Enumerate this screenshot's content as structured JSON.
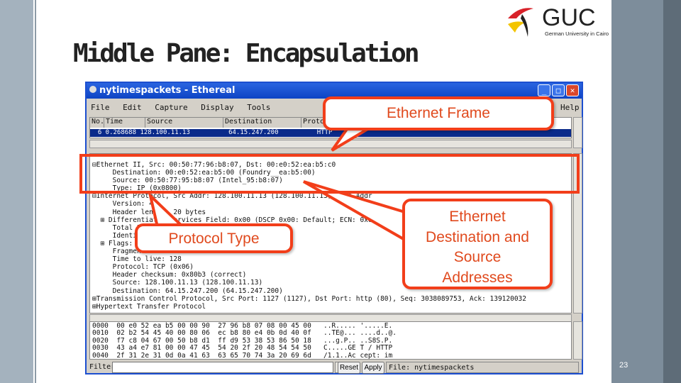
{
  "slide": {
    "title": "Middle Pane: Encapsulation",
    "page_number": "23",
    "logo_text": "GUC",
    "logo_subtext": "German University in Cairo"
  },
  "window": {
    "title": "nytimespackets - Ethereal",
    "menu": [
      "File",
      "Edit",
      "Capture",
      "Display",
      "Tools",
      "Help"
    ],
    "columns": [
      "No.",
      "Time",
      "Source",
      "Destination",
      "Protocol"
    ],
    "selected_row": "  6 0.268688 128.100.11.13          64.15.247.200          HTTP     GET",
    "details": [
      "⊟Ethernet II, Src: 00:50:77:96:b8:07, Dst: 00:e0:52:ea:b5:c0",
      "     Destination: 00:e0:52:ea:b5:00 (Foundry__ea:b5:00)",
      "     Source: 00:50:77:95:b8:07 (Intel_95:b8:07)",
      "     Type: IP (0x0800)",
      "⊟Internet Protocol, Src Addr: 128.100.11.13 (128.100.11.13), Dst Addr",
      "     Version: 4",
      "     Header length: 20 bytes",
      "  ⊞ Differentiated Services Field: 0x00 (DSCP 0x00: Default; ECN: 0x00)",
      "     Total Length: 530",
      "     Identification: 0x0000",
      "  ⊞ Flags: 0x04",
      "     Fragment offset: 0",
      "     Time to live: 128",
      "     Protocol: TCP (0x06)",
      "     Header checksum: 0x80b3 (correct)",
      "     Source: 128.100.11.13 (128.100.11.13)",
      "     Destination: 64.15.247.200 (64.15.247.200)",
      "⊞Transmission Control Protocol, Src Port: 1127 (1127), Dst Port: http (80), Seq: 3038089753, Ack: 139120032",
      "⊞Hypertext Transfer Protocol"
    ],
    "hex": [
      "0000  00 e0 52 ea b5 00 00 90  27 96 b8 07 08 00 45 00   ..R..... '.....E.",
      "0010  02 b2 54 45 40 00 80 06  ec b8 80 e4 0b 0d 40 0f   ..TE@... ....d..@.",
      "0020  f7 c8 04 67 00 50 b8 d1  ff d9 53 38 53 86 50 18   ...g.P.. ..S8S.P.",
      "0030  43 a4 e7 81 00 00 47 45  54 20 2f 20 48 54 54 50   C.....GE T / HTTP",
      "0040  2f 31 2e 31 0d 0a 41 63  63 65 70 74 3a 20 69 6d   /1.1..Ac cept: im"
    ],
    "filter_label": "Filter:",
    "filter_value": "",
    "reset_label": "Reset",
    "apply_label": "Apply",
    "status": "File: nytimespackets"
  },
  "callouts": {
    "frame": "Ethernet Frame",
    "protocol_type": "Protocol Type",
    "addresses": [
      "Ethernet",
      "Destination and",
      "Source",
      "Addresses"
    ]
  },
  "colors": {
    "callout_border": "#f23e1a",
    "callout_text": "#e04a1e",
    "titlebar": "#1c4fd0",
    "selection": "#0a2a8a"
  }
}
